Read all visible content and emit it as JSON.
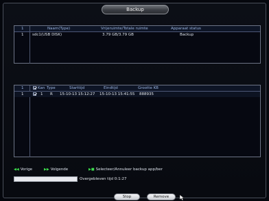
{
  "window": {
    "title": "Backup"
  },
  "devices": {
    "headers": {
      "index": "1",
      "name_type": "Naam(Type)",
      "space": "Vrijeruimte/Totale ruimte",
      "status": "Apparaat status"
    },
    "rows": [
      {
        "index": "1",
        "name_type": "sdc1(USB DISK)",
        "space": "3.79 GB/3.79 GB",
        "status": "Backup"
      }
    ]
  },
  "files": {
    "headers": {
      "index": "1",
      "channel": "Kan",
      "type": "Type",
      "start": "Starttijd",
      "end": "Eindtijd",
      "size": "Grootte KB"
    },
    "rows": [
      {
        "index": "1",
        "checked": true,
        "channel": "1",
        "type": "R",
        "start": "15-10-13 15:12:27",
        "end": "15-10-13 15:41:55",
        "size": "888935"
      }
    ]
  },
  "legend": {
    "prev": "Vorige",
    "next": "Volgende",
    "select": "Selecteer/Annuleer backup app/ber",
    "prev_icon": "skip-back-icon",
    "next_icon": "skip-forward-icon",
    "select_icon": "select-toggle-icon"
  },
  "progress": {
    "value": 0,
    "time_label": "Overgebleven tijd 0:1:27"
  },
  "buttons": {
    "stop": "Stop",
    "remove": "Remove"
  },
  "colors": {
    "accent_green": "#3ddc4c",
    "header_blue": "#9db7e3",
    "panel_border": "#6d7486"
  }
}
